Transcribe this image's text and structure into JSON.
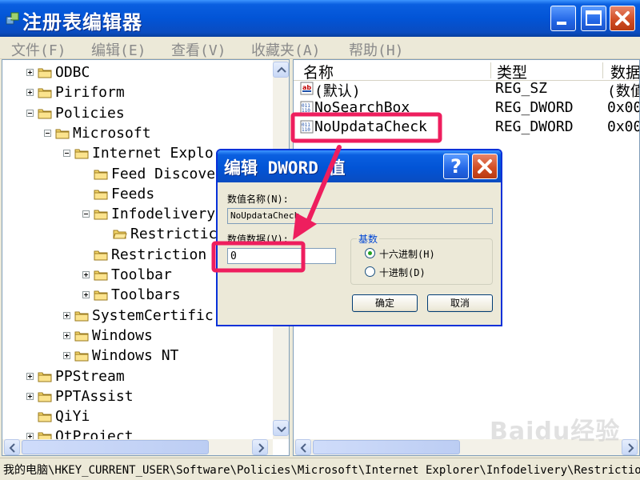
{
  "window": {
    "title": "注册表编辑器",
    "icon": "regedit-icon",
    "controls": [
      "minimize-icon",
      "maximize-icon",
      "close-icon"
    ]
  },
  "menu": {
    "file": "文件(F)",
    "edit": "编辑(E)",
    "view": "查看(V)",
    "favorites": "收藏夹(A)",
    "help": "帮助(H)"
  },
  "tree": {
    "items": [
      {
        "label": "ODBC",
        "expander": "plus"
      },
      {
        "label": "Piriform",
        "expander": "plus"
      },
      {
        "label": "Policies",
        "expander": "minus"
      },
      {
        "label": "Microsoft",
        "expander": "minus"
      },
      {
        "label": "Internet Explo",
        "expander": "minus"
      },
      {
        "label": "Feed Discove",
        "expander": "none"
      },
      {
        "label": "Feeds",
        "expander": "none"
      },
      {
        "label": "Infodelivery",
        "expander": "minus"
      },
      {
        "label": "Restrictic",
        "expander": "none",
        "open": true
      },
      {
        "label": "Restriction",
        "expander": "none"
      },
      {
        "label": "Toolbar",
        "expander": "plus"
      },
      {
        "label": "Toolbars",
        "expander": "plus"
      },
      {
        "label": "SystemCertific",
        "expander": "plus"
      },
      {
        "label": "Windows",
        "expander": "plus"
      },
      {
        "label": "Windows NT",
        "expander": "plus"
      },
      {
        "label": "PPStream",
        "expander": "plus"
      },
      {
        "label": "PPTAssist",
        "expander": "plus"
      },
      {
        "label": "QiYi",
        "expander": "none"
      },
      {
        "label": "QtProject",
        "expander": "plus"
      }
    ]
  },
  "list": {
    "headers": {
      "name": "名称",
      "type": "类型",
      "data": "数据"
    },
    "rows": [
      {
        "name": "(默认)",
        "type": "REG_SZ",
        "data": "(数值",
        "icon": "string-value-icon"
      },
      {
        "name": "NoSearchBox",
        "type": "REG_DWORD",
        "data": "0x00",
        "icon": "dword-value-icon"
      },
      {
        "name": "NoUpdataCheck",
        "type": "REG_DWORD",
        "data": "0x00",
        "icon": "dword-value-icon"
      }
    ]
  },
  "status": {
    "path": "我的电脑\\HKEY_CURRENT_USER\\Software\\Policies\\Microsoft\\Internet Explorer\\Infodelivery\\Restrictions"
  },
  "watermark": "Baidu经验",
  "dialog": {
    "title": "编辑 DWORD 值",
    "help_label": "?",
    "value_name_label": "数值名称(N):",
    "value_name": "NoUpdataCheck",
    "value_data_label": "数值数据(V):",
    "value_data": "0",
    "base_label": "基数",
    "hex_label": "十六进制(H)",
    "dec_label": "十进制(D)",
    "selected_base": "hex",
    "ok_label": "确定",
    "cancel_label": "取消"
  },
  "colors": {
    "title_blue": "#0254d6",
    "highlight_annotation": "#ee1e5e",
    "base_label": "#0046d5"
  }
}
